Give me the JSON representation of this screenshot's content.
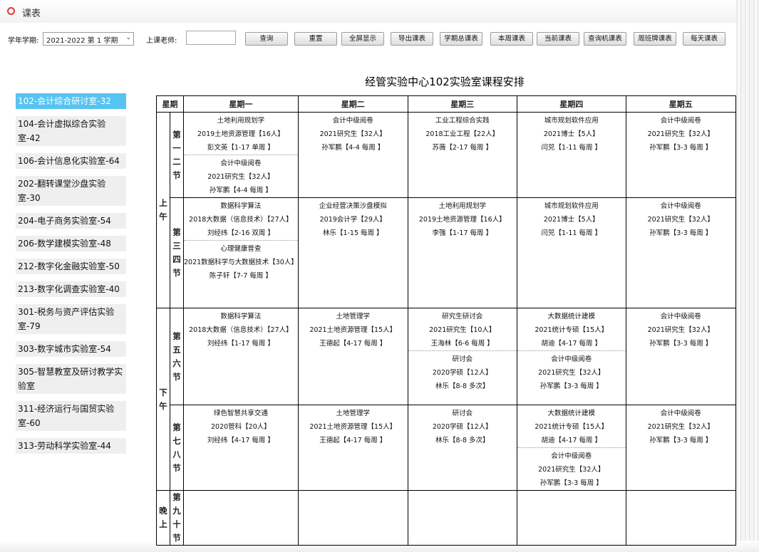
{
  "window": {
    "title": "课表"
  },
  "toolbar": {
    "term_label": "学年学期:",
    "term_value": "2021-2022 第 1 学期",
    "teacher_label": "上课老师:",
    "teacher_value": "",
    "buttons": [
      "查询",
      "重置",
      "全屏显示",
      "导出课表",
      "学期总课表",
      "本周课表",
      "当前课表",
      "查询机课表",
      "周班牌课表",
      "每天课表"
    ]
  },
  "sidebar": {
    "items": [
      {
        "label": "102-会计综合研讨室-32"
      },
      {
        "label": "104-会计虚拟综合实验室-42"
      },
      {
        "label": "106-会计信息化实验室-64"
      },
      {
        "label": "202-翻转课堂沙盘实验室-30"
      },
      {
        "label": "204-电子商务实验室-54"
      },
      {
        "label": "206-数学建模实验室-48"
      },
      {
        "label": "212-数字化金融实验室-50"
      },
      {
        "label": "213-数字化调查实验室-40"
      },
      {
        "label": "301-税务与资产评估实验室-79"
      },
      {
        "label": "303-数字城市实验室-54"
      },
      {
        "label": "305-智慧教室及研讨教学实验室"
      },
      {
        "label": "311-经济运行与国贸实验室-60"
      },
      {
        "label": "313-劳动科学实验室-44"
      }
    ],
    "active": 0
  },
  "schedule": {
    "title": "经管实验中心102实验室课程安排",
    "header": {
      "week": "星期",
      "days": [
        "星期一",
        "星期二",
        "星期三",
        "星期四",
        "星期五"
      ]
    },
    "periods": [
      "上午",
      "下午",
      "晚上"
    ],
    "sections": [
      "第一二节",
      "第三四节",
      "第五六节",
      "第七八节",
      "第九十节"
    ],
    "cells": [
      [
        [
          [
            "土地利用规划学",
            "2019土地资源管理【16人】",
            "彭文英【1-17 单周 】"
          ],
          [
            "会计中级阅卷",
            "2021研究生【32人】",
            "孙军鹏【4-4 每周 】"
          ]
        ],
        [
          [
            "会计中级阅卷",
            "2021研究生【32人】",
            "孙军鹏【4-4 每周 】"
          ]
        ],
        [
          [
            "工业工程综合实践",
            "2018工业工程【22人】",
            "苏薇【2-17 每周 】"
          ]
        ],
        [
          [
            "城市规划软件应用",
            "2021博士【5人】",
            "闫兕【1-11 每周 】"
          ]
        ],
        [
          [
            "会计中级阅卷",
            "2021研究生【32人】",
            "孙军鹏【3-3 每周 】"
          ]
        ]
      ],
      [
        [
          [
            "数据科学算法",
            "2018大数据（信息技术）【27人】",
            "刘经纬【2-16 双周 】"
          ],
          [
            "心理健康普查",
            "2021数据科学与大数据技术【30人】",
            "陈子轩【7-7 每周 】"
          ]
        ],
        [
          [
            "企业经营决策沙盘模拟",
            "2019会计学【29人】",
            "林乐【1-15 每周 】"
          ]
        ],
        [
          [
            "土地利用规划学",
            "2019土地资源管理【16人】",
            "李强【1-17 每周 】"
          ]
        ],
        [
          [
            "城市规划软件应用",
            "2021博士【5人】",
            "闫兕【1-11 每周 】"
          ]
        ],
        [
          [
            "会计中级阅卷",
            "2021研究生【32人】",
            "孙军鹏【3-3 每周 】"
          ]
        ]
      ],
      [
        [
          [
            "数据科学算法",
            "2018大数据（信息技术）【27人】",
            "刘经纬【1-17 每周 】"
          ]
        ],
        [
          [
            "土地管理学",
            "2021土地资源管理【15人】",
            "王德起【4-17 每周 】"
          ]
        ],
        [
          [
            "研究生研讨会",
            "2021研究生【10人】",
            "王海林【6-6 每周 】"
          ],
          [
            "研讨会",
            "2020学硕【12人】",
            "林乐【8-8 多次】"
          ]
        ],
        [
          [
            "大数据统计建模",
            "2021统计专硕【15人】",
            "胡迪【4-17 每周 】"
          ],
          [
            "会计中级阅卷",
            "2021研究生【32人】",
            "孙军鹏【3-3 每周 】"
          ]
        ],
        [
          [
            "会计中级阅卷",
            "2021研究生【32人】",
            "孙军鹏【3-3 每周 】"
          ]
        ]
      ],
      [
        [
          [
            "绿色智慧共享交通",
            "2020管科【20人】",
            "刘经纬【4-17 每周 】"
          ]
        ],
        [
          [
            "土地管理学",
            "2021土地资源管理【15人】",
            "王德起【4-17 每周 】"
          ]
        ],
        [
          [
            "研讨会",
            "2020学硕【12人】",
            "林乐【8-8 多次】"
          ]
        ],
        [
          [
            "大数据统计建模",
            "2021统计专硕【15人】",
            "胡迪【4-17 每周 】"
          ],
          [
            "会计中级阅卷",
            "2021研究生【32人】",
            "孙军鹏【3-3 每周 】"
          ]
        ],
        [
          [
            "会计中级阅卷",
            "2021研究生【32人】",
            "孙军鹏【3-3 每周 】"
          ]
        ]
      ],
      [
        [],
        [],
        [],
        [],
        []
      ]
    ]
  }
}
